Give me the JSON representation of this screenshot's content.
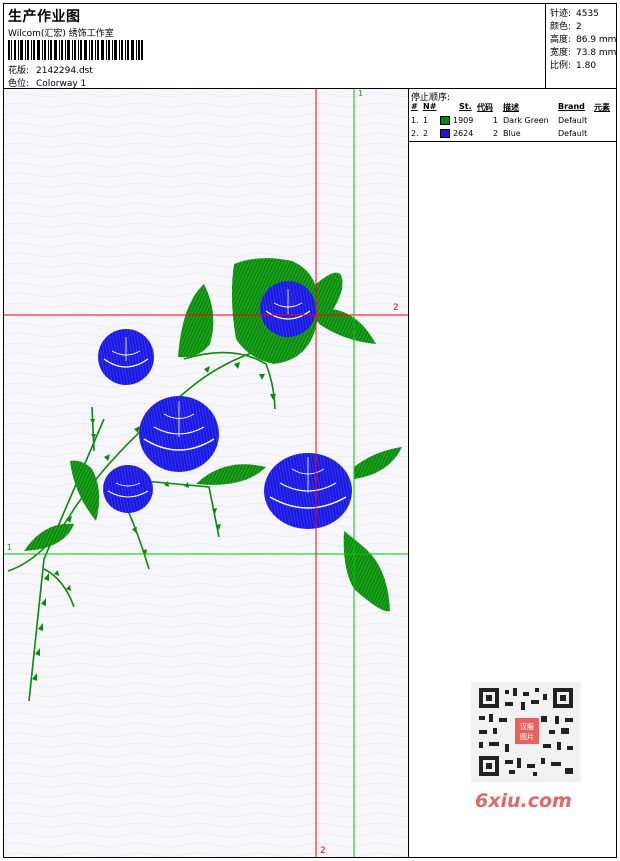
{
  "header": {
    "title": "生产作业图",
    "studio": "Wilcom(汇宏) 绣饰工作室",
    "design_label": "花版:",
    "design_value": "2142294.dst",
    "colorway_label": "色位:",
    "colorway_value": "Colorway 1"
  },
  "stats": [
    {
      "label": "针迹:",
      "value": "4535"
    },
    {
      "label": "颜色:",
      "value": "2"
    },
    {
      "label": "高度:",
      "value": "86.9 mm"
    },
    {
      "label": "宽度:",
      "value": "73.8 mm"
    },
    {
      "label": "比例:",
      "value": "1.80"
    }
  ],
  "stop_sequence": {
    "title": "停止顺序:",
    "columns": [
      "#",
      "N#",
      "St.",
      "代码",
      "描述",
      "Brand",
      "元素"
    ],
    "rows": [
      {
        "index": "1.",
        "n": "1",
        "color": "#0a8a0a",
        "stitches": "1909",
        "code": "1",
        "description": "Dark Green",
        "brand": "Default"
      },
      {
        "index": "2.",
        "n": "2",
        "color": "#1818e0",
        "stitches": "2624",
        "code": "2",
        "description": "Blue",
        "brand": "Default"
      }
    ]
  },
  "guides": {
    "green_h_label": "1",
    "green_v_label": "1",
    "red_h_label": "2",
    "red_v_label": "2"
  },
  "colors": {
    "thread_green": "#0a8a0a",
    "thread_blue": "#1818e0",
    "guide_red": "#ff0000",
    "guide_green": "#00cc00"
  },
  "watermark": {
    "site": "6xiu.com",
    "seal_text": "汉服图片"
  }
}
